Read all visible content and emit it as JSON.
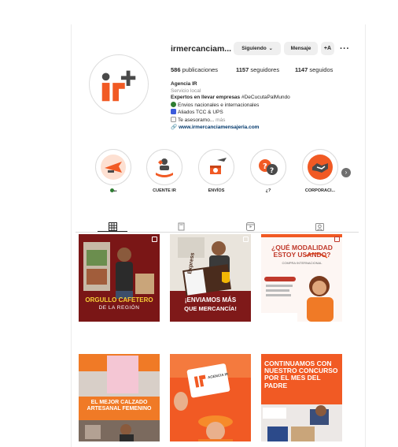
{
  "profile": {
    "username": "irmercanciam...",
    "follow_label": "Siguiendo",
    "message_label": "Mensaje",
    "add_label": "+А",
    "more_label": "···",
    "stats": {
      "posts_count": "586",
      "posts_label": "publicaciones",
      "followers_count": "1157",
      "followers_label": "seguidores",
      "following_count": "1147",
      "following_label": "seguidos"
    },
    "bio": {
      "name": "Agencia IR",
      "category": "Servicio local",
      "line1": "Expertos en llevar empresas",
      "line1_tag": "#DeCucutaPalMundo",
      "line2": "Envios nacionales e internacionales",
      "line3": "Aliados TCC & UPS",
      "line4": "Te asesoramo...",
      "line4_more": "más",
      "link": "www.irmercanciamensajeria.com"
    }
  },
  "highlights": [
    {
      "label": "••"
    },
    {
      "label": "CUENTE IR"
    },
    {
      "label": "ENVÍOS"
    },
    {
      "label": "¿?"
    },
    {
      "label": "CORPORACI..."
    }
  ],
  "posts": [
    {
      "title": "ORGULLO CAFETERO",
      "subtitle": "DE LA REGIÓN"
    },
    {
      "title": "¡ENVIAMOS MÁS",
      "subtitle": "QUE MERCANCÍA!",
      "card_text": "Express"
    },
    {
      "title": "¿QUÉ MODALIDAD ESTOY USANDO?",
      "subtitle": "COMPRA INTERNACIONAL"
    },
    {
      "title": "EL MEJOR CALZADO ARTESANAL FEMENINO"
    },
    {
      "title": "AGENCIA IR"
    },
    {
      "title": "CONTINUAMOS CON NUESTRO CONCURSO POR EL MES DEL PADRE"
    }
  ],
  "colors": {
    "brand_orange": "#f15a24",
    "brand_dark": "#4a4a4a",
    "post_red": "#8b1a1a",
    "accent_blue": "#00376b"
  }
}
